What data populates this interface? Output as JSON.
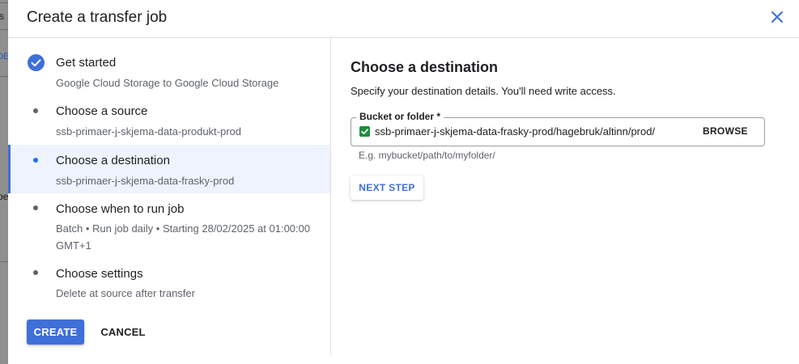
{
  "background": {
    "fragments": [
      "s",
      "DE",
      "oe"
    ]
  },
  "dialog": {
    "title": "Create a transfer job",
    "close_icon": "close-icon"
  },
  "steps": [
    {
      "title": "Get started",
      "subtitle": "Google Cloud Storage to Google Cloud Storage",
      "state": "completed",
      "icon": "check-circle-icon"
    },
    {
      "title": "Choose a source",
      "subtitle": "ssb-primaer-j-skjema-data-produkt-prod",
      "state": "pending",
      "icon": "dot-icon"
    },
    {
      "title": "Choose a destination",
      "subtitle": "ssb-primaer-j-skjema-data-frasky-prod",
      "state": "active",
      "icon": "dot-icon"
    },
    {
      "title": "Choose when to run job",
      "subtitle_line1": "Batch • Run job daily • Starting 28/02/2025 at 01:00:00",
      "subtitle_line2": "GMT+1",
      "state": "pending",
      "icon": "dot-icon"
    },
    {
      "title": "Choose settings",
      "subtitle": "Delete at source after transfer",
      "state": "pending",
      "icon": "dot-icon"
    }
  ],
  "actions": {
    "create_label": "CREATE",
    "cancel_label": "CANCEL"
  },
  "destination": {
    "heading": "Choose a destination",
    "description": "Specify your destination details. You'll need write access.",
    "field_label": "Bucket or folder *",
    "field_value": "ssb-primaer-j-skjema-data-frasky-prod/hagebruk/altinn/prod/",
    "browse_label": "BROWSE",
    "hint": "E.g. mybucket/path/to/myfolder/",
    "next_step_label": "NEXT STEP"
  },
  "colors": {
    "accent": "#3f6fd8",
    "active_step_bg": "#eef3fd",
    "valid_green": "#1e8e3e"
  }
}
